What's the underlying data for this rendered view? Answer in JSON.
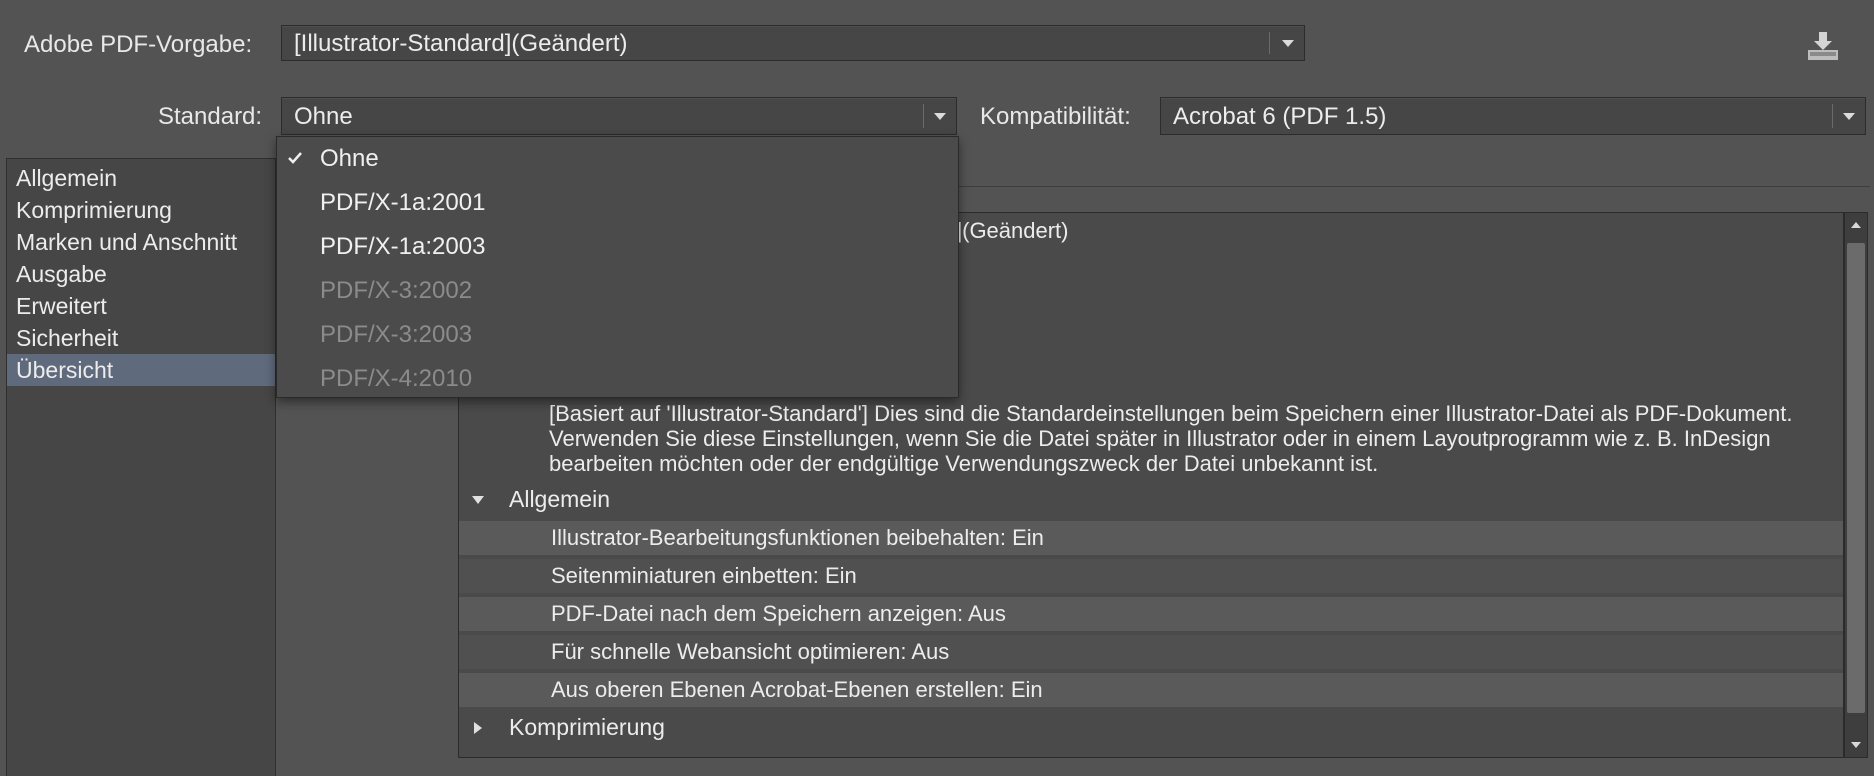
{
  "header": {
    "preset_label": "Adobe PDF-Vorgabe:",
    "preset_value": "[Illustrator-Standard](Geändert)",
    "standard_label": "Standard:",
    "standard_value": "Ohne",
    "compat_label": "Kompatibilität:",
    "compat_value": "Acrobat 6 (PDF 1.5)",
    "save_icon": "save-preset-icon"
  },
  "sidebar": {
    "items": [
      {
        "label": "Allgemein",
        "active": false
      },
      {
        "label": "Komprimierung",
        "active": false
      },
      {
        "label": "Marken und Anschnitt",
        "active": false
      },
      {
        "label": "Ausgabe",
        "active": false
      },
      {
        "label": "Erweitert",
        "active": false
      },
      {
        "label": "Sicherheit",
        "active": false
      },
      {
        "label": "Übersicht",
        "active": true
      }
    ]
  },
  "standard_menu": {
    "items": [
      {
        "label": "Ohne",
        "checked": true,
        "enabled": true
      },
      {
        "label": "PDF/X-1a:2001",
        "checked": false,
        "enabled": true
      },
      {
        "label": "PDF/X-1a:2003",
        "checked": false,
        "enabled": true
      },
      {
        "label": "PDF/X-3:2002",
        "checked": false,
        "enabled": false
      },
      {
        "label": "PDF/X-3:2003",
        "checked": false,
        "enabled": false
      },
      {
        "label": "PDF/X-4:2010",
        "checked": false,
        "enabled": false
      }
    ]
  },
  "summary": {
    "visible_title_fragment": "](Geändert)",
    "description": "[Basiert auf 'Illustrator-Standard'] Dies sind die Standardeinstellungen beim Speichern einer Illustrator-Datei als PDF-Dokument. Verwenden Sie diese Einstellungen, wenn Sie die Datei später in Illustrator oder in einem Layoutprogramm wie z. B. InDesign bearbeiten möchten oder der endgültige Verwendungszweck der Datei unbekannt ist.",
    "sections": [
      {
        "label": "Allgemein",
        "expanded": true,
        "rows": [
          "Illustrator-Bearbeitungsfunktionen beibehalten: Ein",
          "Seitenminiaturen einbetten: Ein",
          "PDF-Datei nach dem Speichern anzeigen: Aus",
          "Für schnelle Webansicht optimieren: Aus",
          "Aus oberen Ebenen Acrobat-Ebenen erstellen: Ein"
        ]
      },
      {
        "label": "Komprimierung",
        "expanded": false,
        "rows": []
      }
    ]
  },
  "colors": {
    "background": "#535353",
    "panel": "#4a4a4a",
    "selection": "#5f6a7c",
    "disabled_text": "#8b8b8b"
  }
}
